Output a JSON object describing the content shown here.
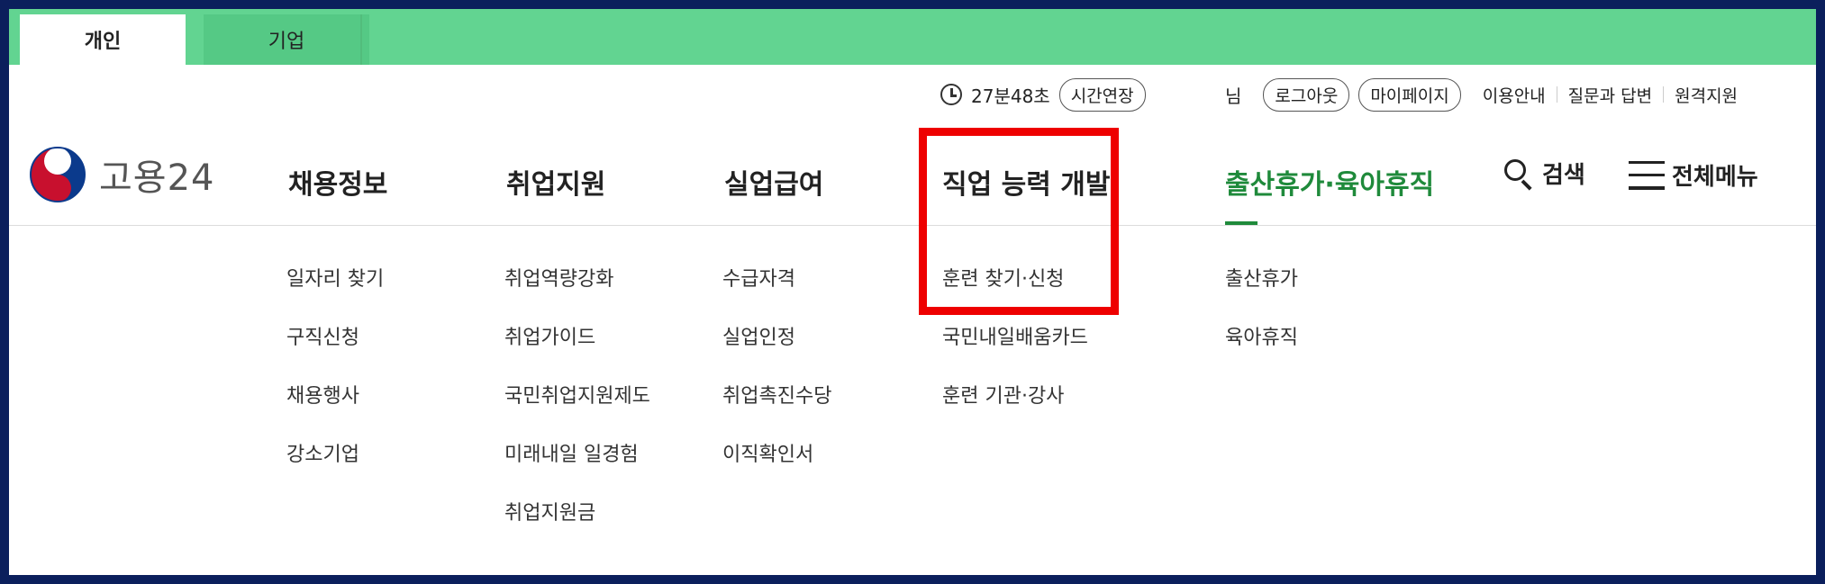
{
  "top_tabs": [
    {
      "label": "개인",
      "active": true
    },
    {
      "label": "기업",
      "active": false
    }
  ],
  "utility": {
    "timer": "27분48초",
    "extend_label": "시간연장",
    "user_suffix": "님",
    "logout_label": "로그아웃",
    "mypage_label": "마이페이지",
    "links": [
      "이용안내",
      "질문과 답변",
      "원격지원"
    ]
  },
  "logo": {
    "text": "고용24"
  },
  "main_nav": [
    {
      "label": "채용정보"
    },
    {
      "label": "취업지원"
    },
    {
      "label": "실업급여"
    },
    {
      "label": "직업 능력 개발",
      "highlighted": true
    },
    {
      "label": "출산휴가·육아휴직",
      "active": true
    }
  ],
  "search_label": "검색",
  "all_menu_label": "전체메뉴",
  "submenus": [
    [
      "일자리 찾기",
      "구직신청",
      "채용행사",
      "강소기업"
    ],
    [
      "취업역량강화",
      "취업가이드",
      "국민취업지원제도",
      "미래내일 일경험",
      "취업지원금"
    ],
    [
      "수급자격",
      "실업인정",
      "취업촉진수당",
      "이직확인서"
    ],
    [
      "훈련 찾기·신청",
      "국민내일배움카드",
      "훈련 기관·강사"
    ],
    [
      "출산휴가",
      "육아휴직"
    ]
  ],
  "colors": {
    "top_bar": "#62d491",
    "active_nav": "#1f8a3b",
    "highlight_box": "#ee0000",
    "page_border": "#0b1f5c"
  }
}
